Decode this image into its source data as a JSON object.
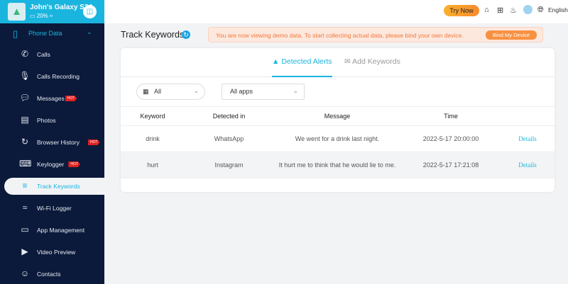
{
  "device": {
    "name": "John's Galaxy S24",
    "battery": "20%"
  },
  "sidebar": {
    "section": "Phone Data",
    "hot_label": "HOT",
    "items": [
      {
        "label": "Calls",
        "icon": "phone-icon",
        "hot": false
      },
      {
        "label": "Calls Recording",
        "icon": "microphone-icon",
        "hot": false
      },
      {
        "label": "Messages",
        "icon": "chat-bubble-icon",
        "hot": true
      },
      {
        "label": "Photos",
        "icon": "image-icon",
        "hot": false
      },
      {
        "label": "Browser History",
        "icon": "history-icon",
        "hot": true
      },
      {
        "label": "Keylogger",
        "icon": "keyboard-icon",
        "hot": true
      },
      {
        "label": "Track Keywords",
        "icon": "keyword-search-icon",
        "hot": false,
        "active": true
      },
      {
        "label": "Wi-Fi Logger",
        "icon": "wifi-icon",
        "hot": false
      },
      {
        "label": "App Management",
        "icon": "app-icon",
        "hot": false
      },
      {
        "label": "Video Preview",
        "icon": "video-icon",
        "hot": false
      },
      {
        "label": "Contacts",
        "icon": "contacts-icon",
        "hot": false
      }
    ]
  },
  "topbar": {
    "try_now": "Try Now",
    "language": "English"
  },
  "page": {
    "title": "Track Keywords",
    "banner": "You are now viewing demo data. To start collecting actual data, please bind your own device.",
    "bind_button": "Bind My Device"
  },
  "tabs": [
    {
      "label": "Detected Alerts",
      "active": true
    },
    {
      "label": "Add Keywords",
      "active": false
    }
  ],
  "filters": {
    "date": "All",
    "apps": "All apps"
  },
  "table": {
    "headers": [
      "Keyword",
      "Detected in",
      "Message",
      "Time",
      ""
    ],
    "rows": [
      {
        "keyword": "drink",
        "app": "WhatsApp",
        "message": "We went for a drink last night.",
        "time": "2022-5-17 20:00:00",
        "action": "Details"
      },
      {
        "keyword": "hurt",
        "app": "Instagram",
        "message": "It hurt me to think that he would lie to me.",
        "time": "2022-5-17 17:21:08",
        "action": "Details"
      }
    ]
  },
  "colors": {
    "accent": "#1ab5df",
    "sidebar": "#0b1a3b",
    "warning": "#f07838"
  }
}
